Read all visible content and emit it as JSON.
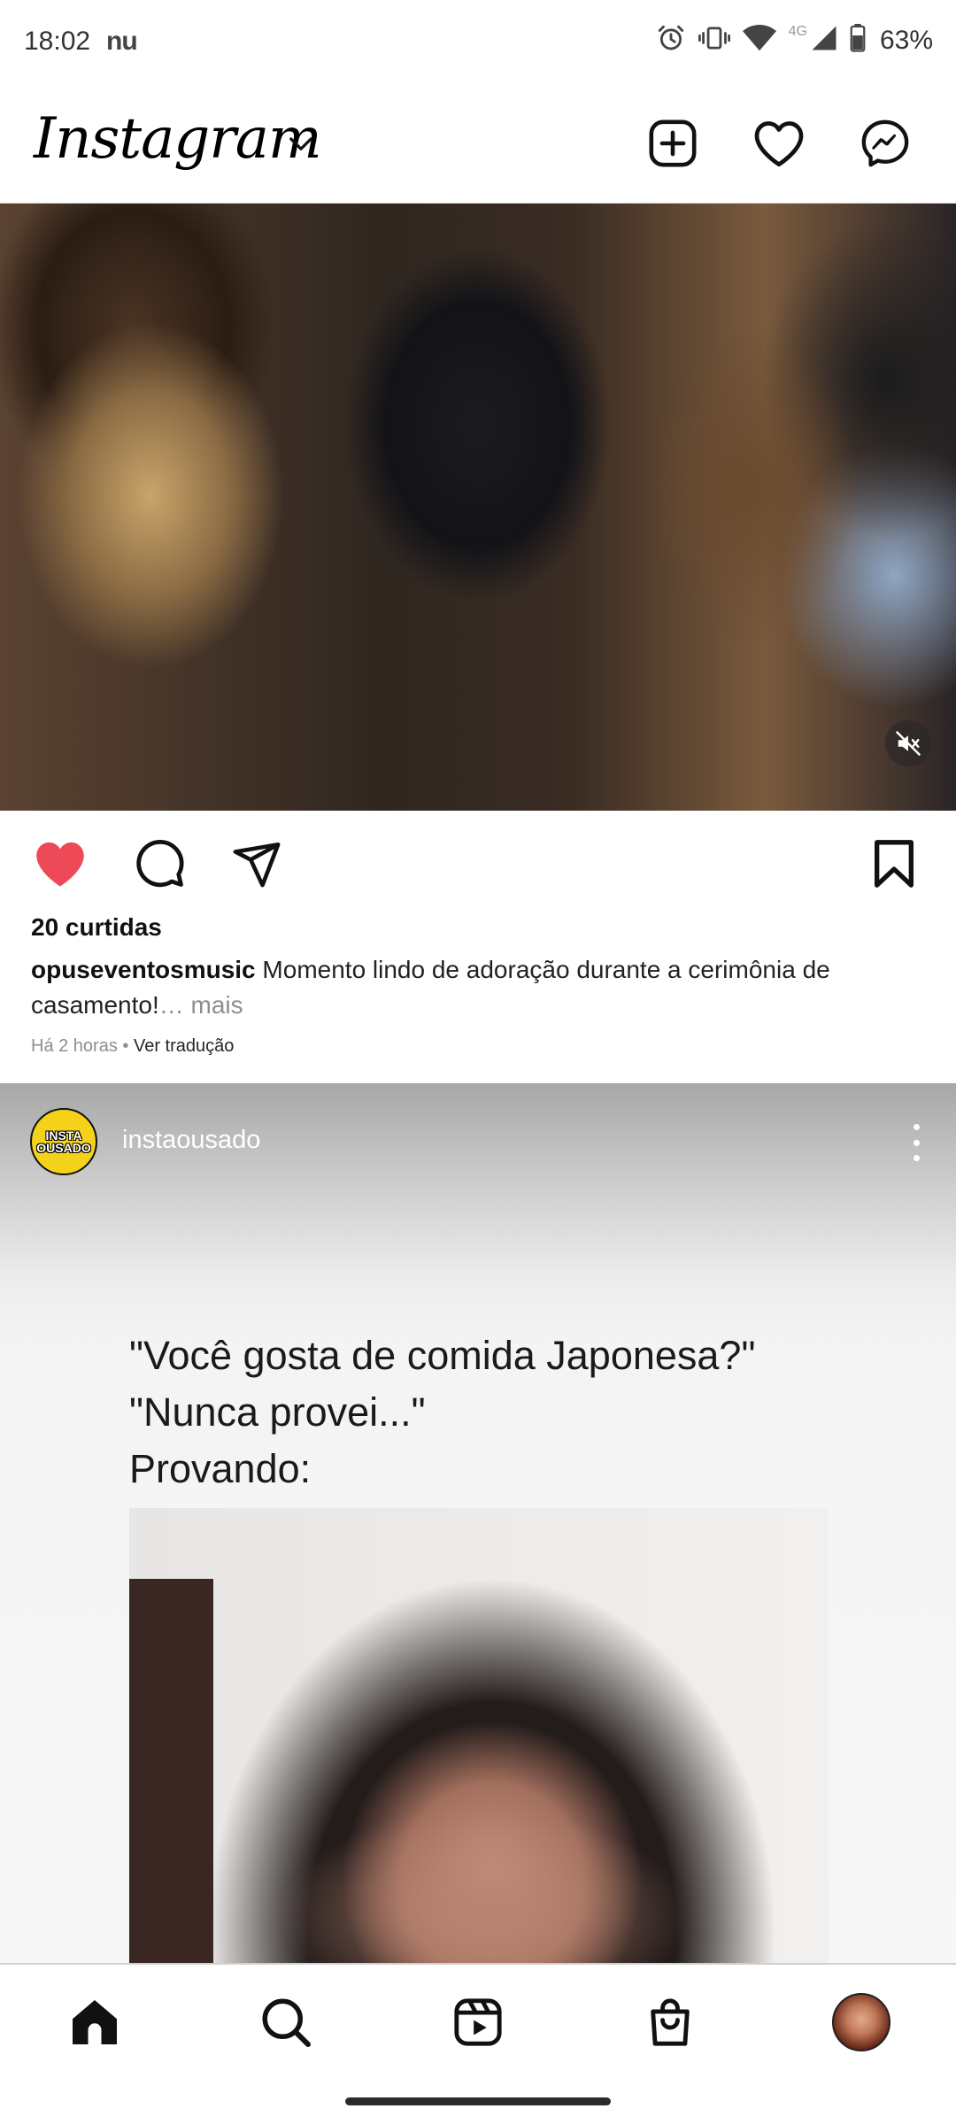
{
  "status_bar": {
    "time": "18:02",
    "carrier": "nu",
    "network": "4G",
    "battery": "63%"
  },
  "header": {
    "logo": "Instagram"
  },
  "post1": {
    "likes": "20 curtidas",
    "username": "opuseventosmusic",
    "caption": "Momento lindo de adoração durante a cerimônia de casamento!",
    "ellipsis_more": "… mais",
    "time_ago": "Há 2 horas",
    "separator": " • ",
    "translate": "Ver tradução"
  },
  "post2": {
    "avatar_line1": "INSTA",
    "avatar_line2": "OUSADO",
    "username": "instaousado",
    "meme_line1": "\"Você gosta de comida Japonesa?\"",
    "meme_line2": "\"Nunca provei...\"",
    "meme_line3": "Provando:"
  },
  "colors": {
    "like_red": "#ed4956",
    "text_primary": "#111111",
    "text_secondary": "#8e8e8e"
  },
  "icons": {
    "header": [
      "chevron-down-icon",
      "add-post-icon",
      "heart-icon",
      "messenger-icon"
    ],
    "post_actions": [
      "heart-filled-icon",
      "comment-icon",
      "share-icon",
      "bookmark-icon"
    ],
    "bottom_nav": [
      "home-icon",
      "search-icon",
      "reels-icon",
      "shop-icon",
      "profile-avatar"
    ]
  }
}
